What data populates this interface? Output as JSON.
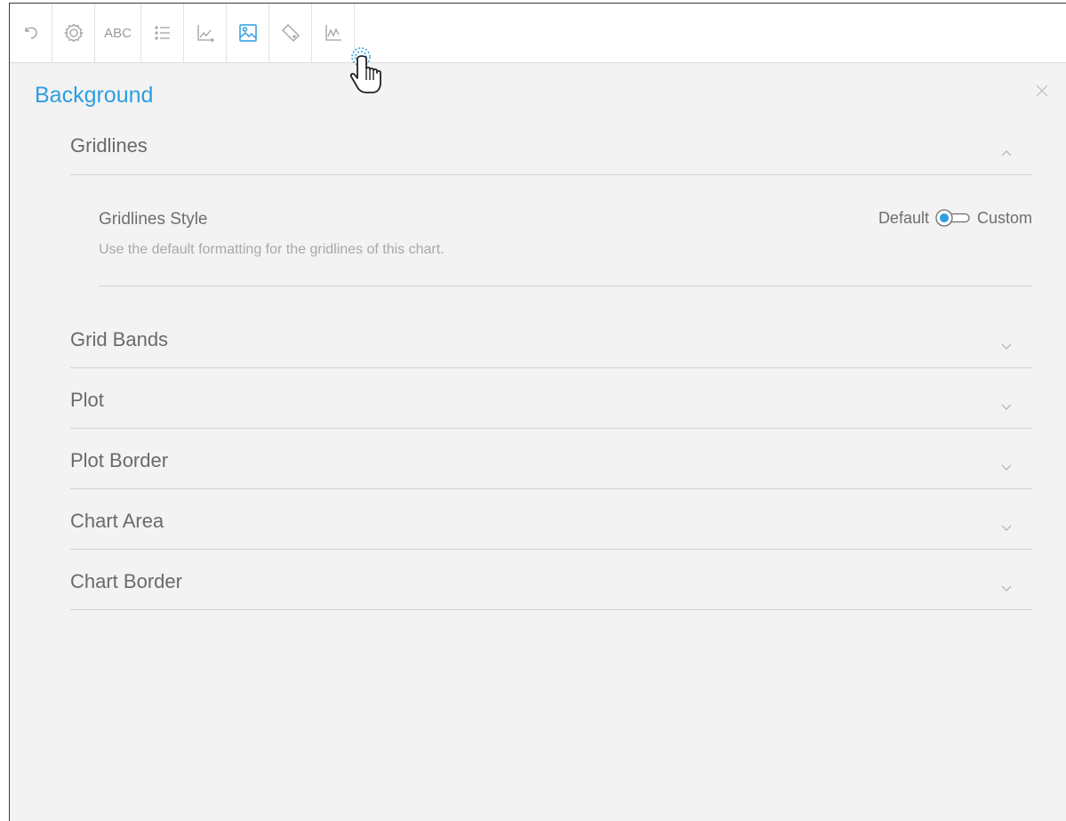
{
  "toolbar": {
    "buttons": [
      {
        "name": "undo-icon"
      },
      {
        "name": "gear-icon"
      },
      {
        "name": "abc-text",
        "label": "ABC"
      },
      {
        "name": "list-icon"
      },
      {
        "name": "axis-chart-icon"
      },
      {
        "name": "image-icon",
        "active": true
      },
      {
        "name": "tag-icon"
      },
      {
        "name": "line-chart-icon"
      }
    ]
  },
  "panel": {
    "title": "Background",
    "sections": {
      "gridlines": "Gridlines",
      "grid_bands": "Grid Bands",
      "plot": "Plot",
      "plot_border": "Plot Border",
      "chart_area": "Chart Area",
      "chart_border": "Chart Border"
    },
    "gridlines_style": {
      "title": "Gridlines Style",
      "description": "Use the default formatting for the gridlines of this chart.",
      "toggle_left": "Default",
      "toggle_right": "Custom"
    }
  },
  "colors": {
    "accent": "#2d9ee0",
    "background": "#f3f3f3",
    "text": "#6a6a6a",
    "muted_text": "#a8a8a8",
    "divider": "#d3d3d3"
  }
}
